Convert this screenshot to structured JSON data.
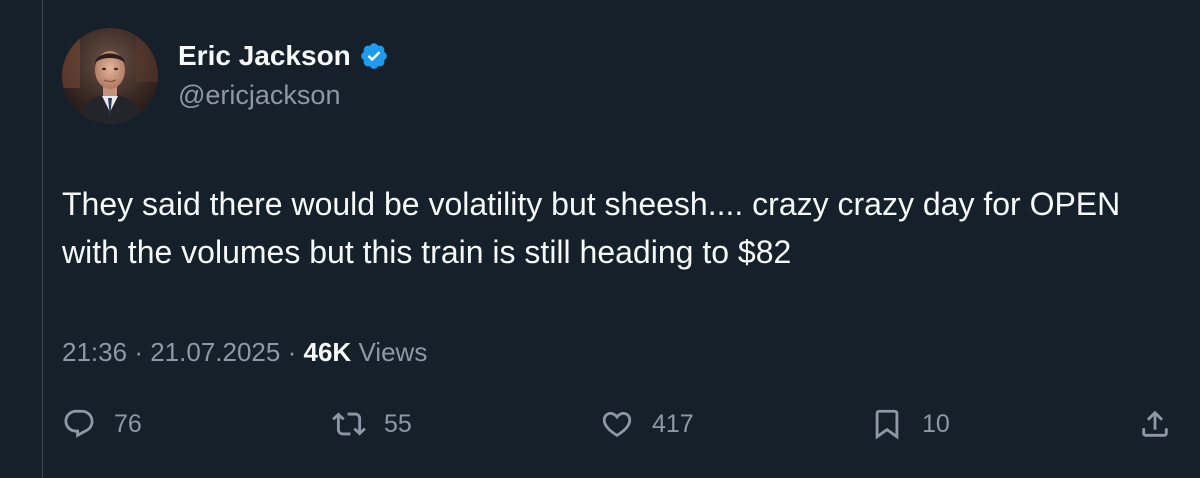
{
  "author": {
    "display_name": "Eric Jackson",
    "handle": "@ericjackson",
    "verified_badge_icon": "verified-badge-icon",
    "verified_color": "#1d9bf0"
  },
  "tweet": {
    "text": "They said there would be volatility but sheesh.... crazy crazy day for OPEN with the volumes but this train is still heading to $82"
  },
  "meta": {
    "time": "21:36",
    "separator": "·",
    "date": "21.07.2025",
    "views_count": "46K",
    "views_label": "Views"
  },
  "actions": {
    "reply": {
      "icon": "reply-icon",
      "count": "76"
    },
    "retweet": {
      "icon": "retweet-icon",
      "count": "55"
    },
    "like": {
      "icon": "heart-icon",
      "count": "417"
    },
    "bookmark": {
      "icon": "bookmark-icon",
      "count": "10"
    },
    "share": {
      "icon": "share-icon"
    }
  },
  "colors": {
    "background": "#15202b",
    "text_primary": "#f7f9f9",
    "text_secondary": "#8b98a5"
  }
}
